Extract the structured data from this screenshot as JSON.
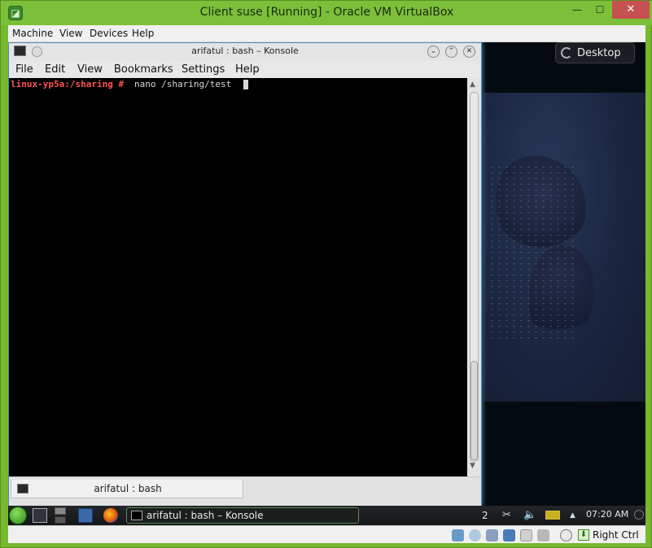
{
  "host_window": {
    "title": "Client suse [Running] - Oracle VM VirtualBox",
    "minimize_glyph": "—",
    "maximize_glyph": "☐",
    "close_glyph": "✕",
    "menu": [
      "Machine",
      "View",
      "Devices",
      "Help"
    ],
    "host_key_label": "Right Ctrl"
  },
  "guest": {
    "desktop_button_label": "Desktop",
    "konsole": {
      "title": "arifatul : bash – Konsole",
      "menu": [
        "File",
        "Edit",
        "View",
        "Bookmarks",
        "Settings",
        "Help"
      ],
      "prompt": "linux-yp5a:/sharing #",
      "command": "nano /sharing/test",
      "tab_label": "arifatul : bash",
      "scroll_up_glyph": "▲",
      "scroll_down_glyph": "▼",
      "minimize_glyph": "⌄",
      "maximize_glyph": "⌃",
      "close_glyph": "✕"
    },
    "panel": {
      "task_label": "arifatul : bash – Konsole",
      "virtual_desktop": "2",
      "clock": "07:20 AM",
      "tray_icons": [
        "scissors-icon",
        "volume-icon",
        "battery-icon",
        "expand-arrow-icon"
      ],
      "tray_glyphs": {
        "scissors": "✂",
        "volume": "🔈",
        "arrow": "▲"
      }
    }
  },
  "colors": {
    "host_frame": "#7cc03a",
    "prompt_red": "#ff5454",
    "terminal_bg": "#000000"
  }
}
